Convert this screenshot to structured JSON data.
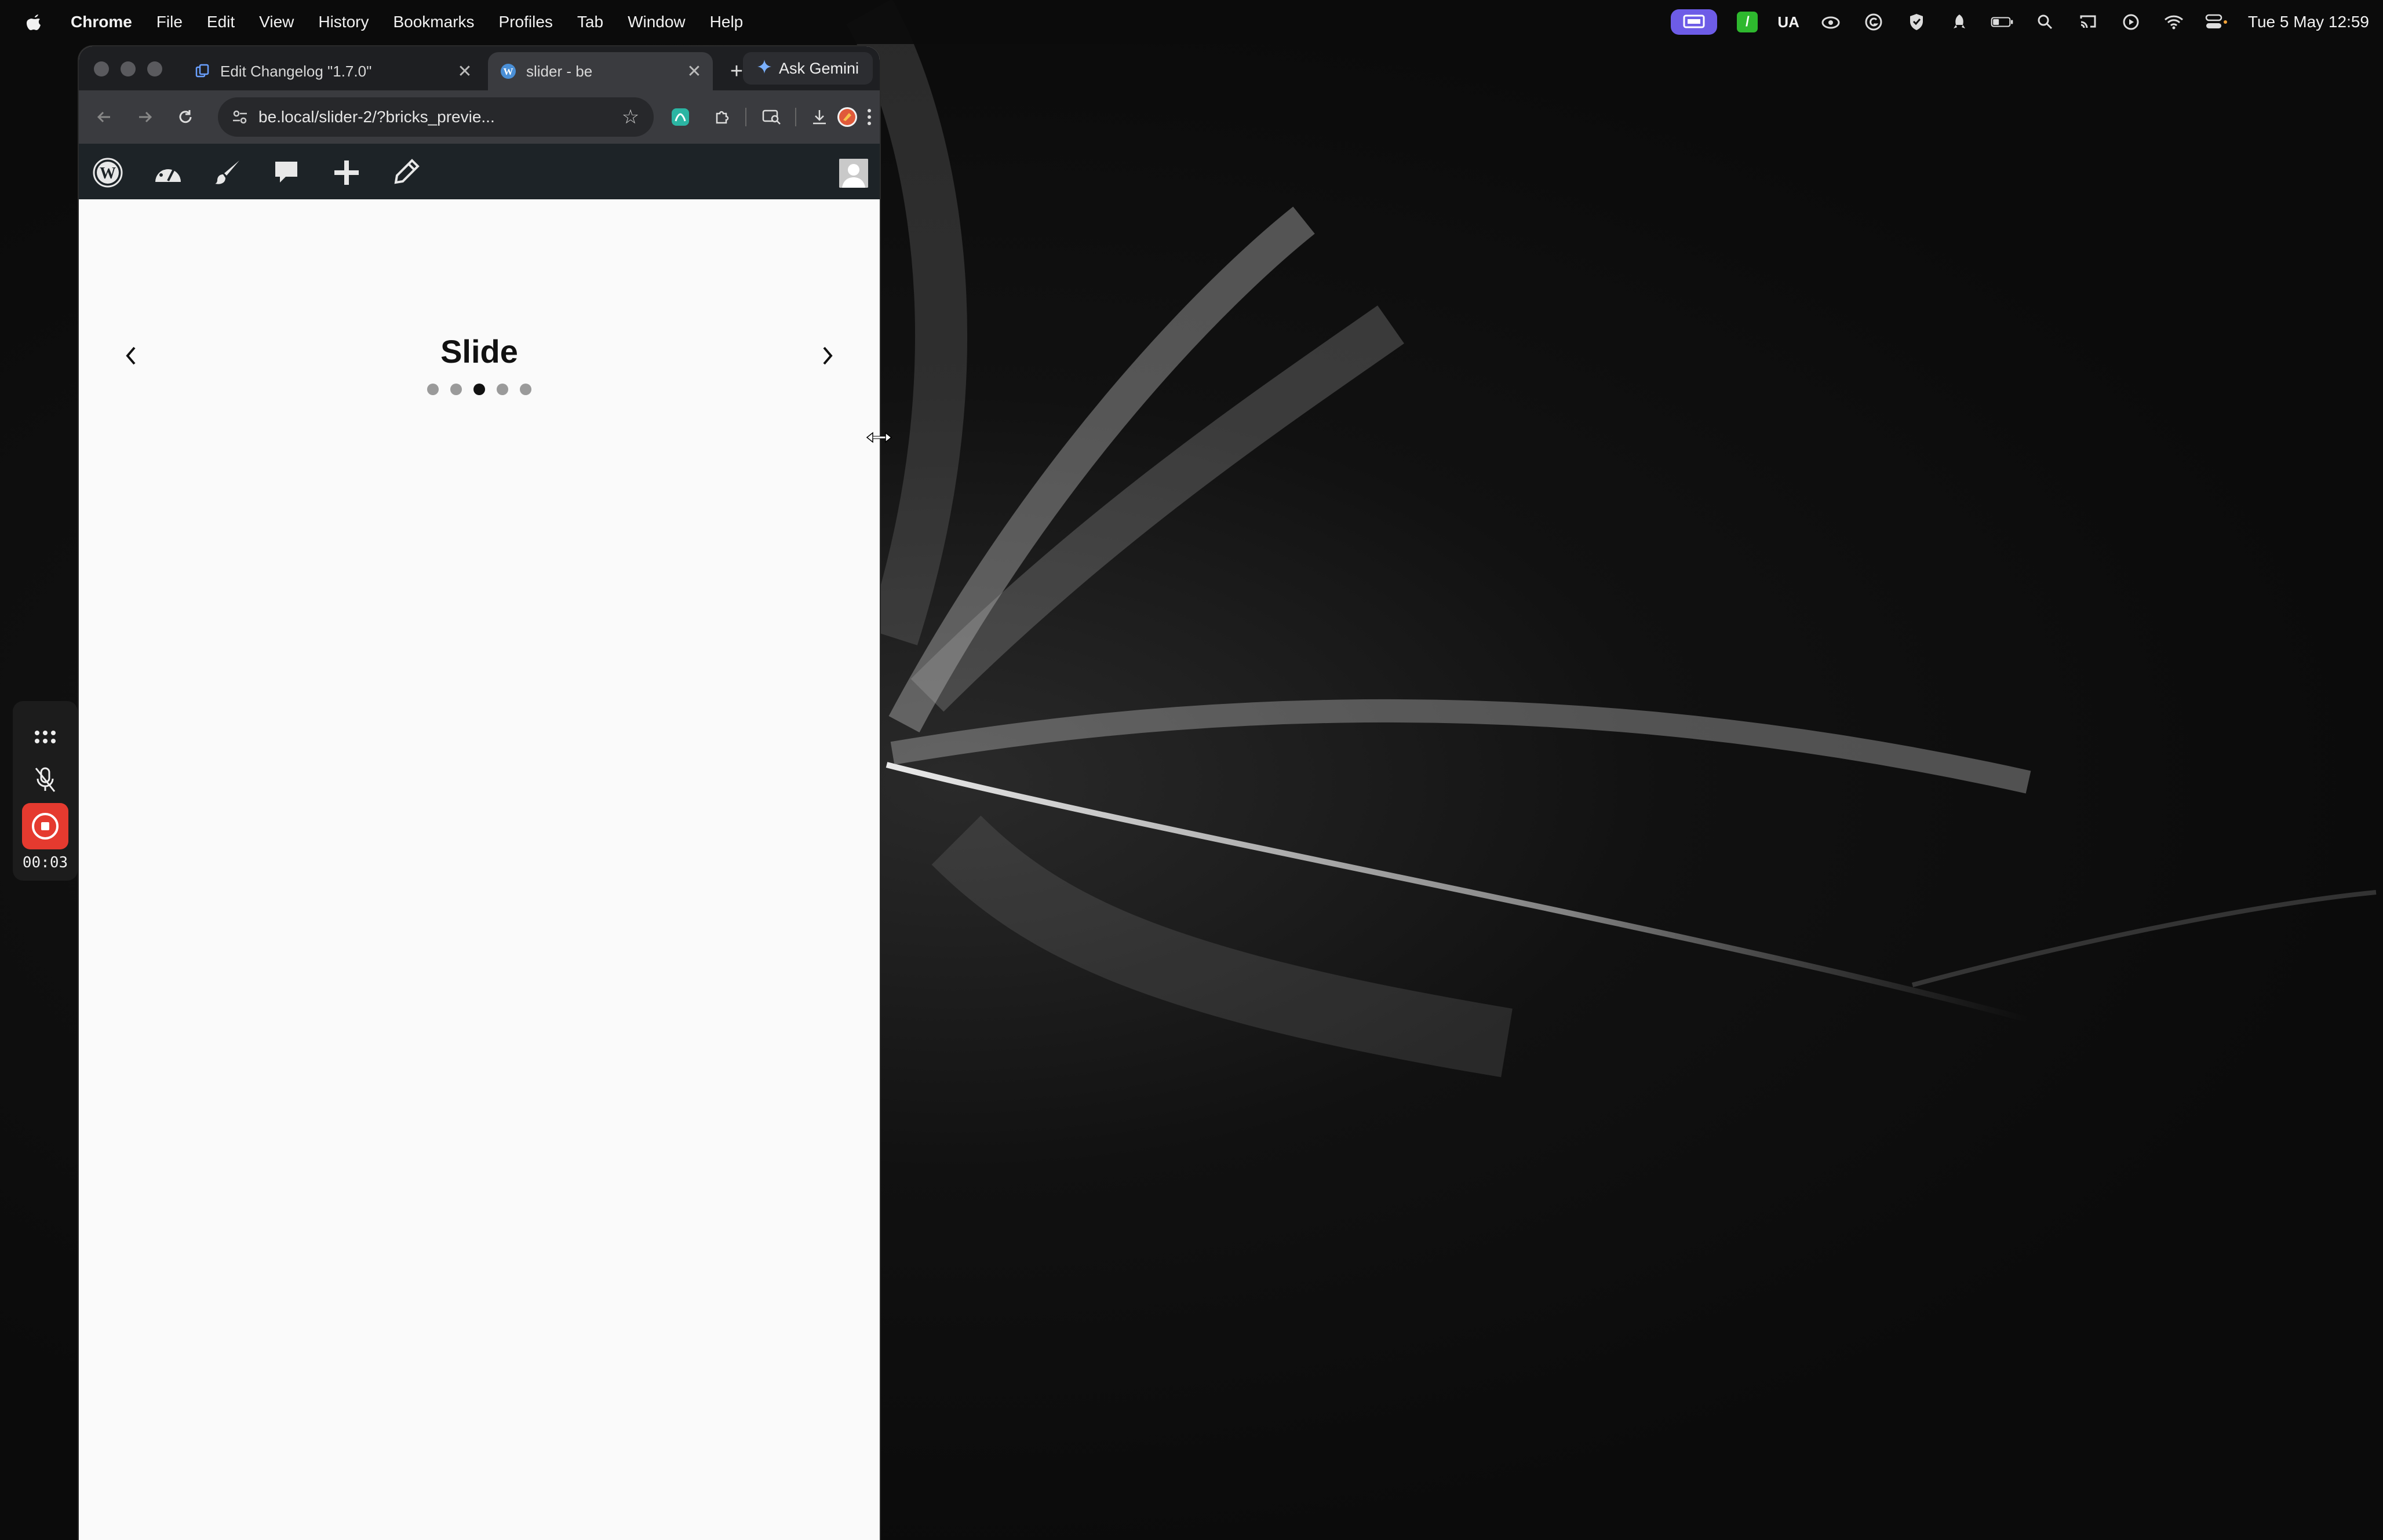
{
  "menubar": {
    "app_name": "Chrome",
    "menus": [
      "File",
      "Edit",
      "View",
      "History",
      "Bookmarks",
      "Profiles",
      "Tab",
      "Window",
      "Help"
    ],
    "status_text_ua": "UA",
    "clock": "Tue 5 May  12:59",
    "icons": [
      "apple-icon",
      "screen-share-icon",
      "green-app-icon",
      "creative-cloud-icon",
      "grammarly-icon",
      "shield-icon",
      "rocket-icon",
      "battery-icon",
      "spotlight-search-icon",
      "cast-icon",
      "play-icon",
      "wifi-icon",
      "control-center-icon"
    ]
  },
  "browser": {
    "tabs": [
      {
        "label": "Edit Changelog \"1.7.0\"",
        "favicon": "document-icon"
      },
      {
        "label": "slider - be",
        "favicon": "wordpress-icon",
        "active": true
      }
    ],
    "ask_gemini_label": "Ask Gemini",
    "url": "be.local/slider-2/?bricks_previe..."
  },
  "wp_adminbar": {
    "items": [
      "wordpress-logo-icon",
      "dashboard-icon",
      "customize-brush-icon",
      "comments-icon",
      "new-content-plus-icon",
      "edit-pencil-icon"
    ]
  },
  "slider": {
    "title": "Slide",
    "prev_arrow": "‹",
    "next_arrow": "›",
    "total_slides": 5,
    "active_index": 3
  },
  "recorder": {
    "time": "00:03"
  },
  "colors": {
    "accent_record": "#e53a2f",
    "menubar_badge": "#6d5ce7",
    "wp_adminbar": "#1d2327"
  }
}
